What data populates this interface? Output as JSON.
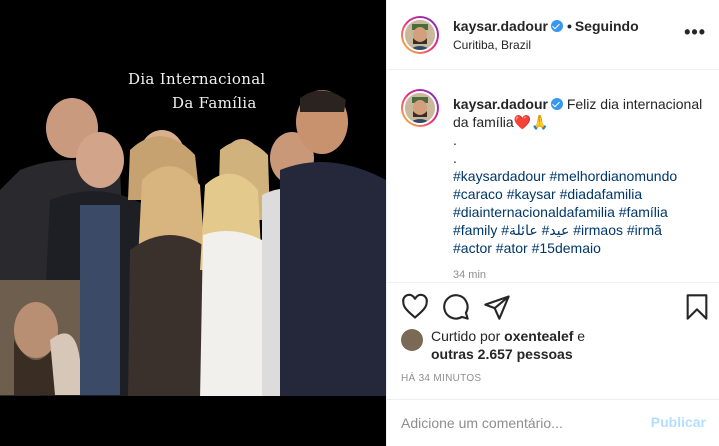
{
  "media": {
    "overlay_line1": "Dia Internacional",
    "overlay_line2": "Da Família"
  },
  "header": {
    "username": "kaysar.dadour",
    "separator": "•",
    "follow_status": "Seguindo",
    "location": "Curitiba, Brazil",
    "more_icon": "more-horizontal-icon"
  },
  "caption": {
    "username": "kaysar.dadour",
    "text": "Feliz dia internacional da família",
    "emoji": "❤️🙏",
    "dots": [
      ".",
      "."
    ],
    "hashtags": "#kaysardadour #melhordianomundo #caraco #kaysar #diadafamilia #diainternacionaldafamilia #família #family #عائلة‎ #عيد #irmaos #irmã #actor #ator #15demaio",
    "time_partial": "34 min"
  },
  "actions": {
    "like_icon": "heart-icon",
    "comment_icon": "comment-icon",
    "share_icon": "paper-plane-icon",
    "save_icon": "bookmark-icon"
  },
  "likes": {
    "prefix": "Curtido por",
    "user": "oxentealef",
    "joiner": "e",
    "others": "outras 2.657 pessoas"
  },
  "post_time": "HÁ 34 MINUTOS",
  "add_comment": {
    "placeholder": "Adicione um comentário...",
    "publish_label": "Publicar"
  },
  "colors": {
    "link": "#00376b",
    "verified": "#3897f0",
    "publish_disabled": "#b2dffc",
    "muted": "#8e8e8e"
  }
}
